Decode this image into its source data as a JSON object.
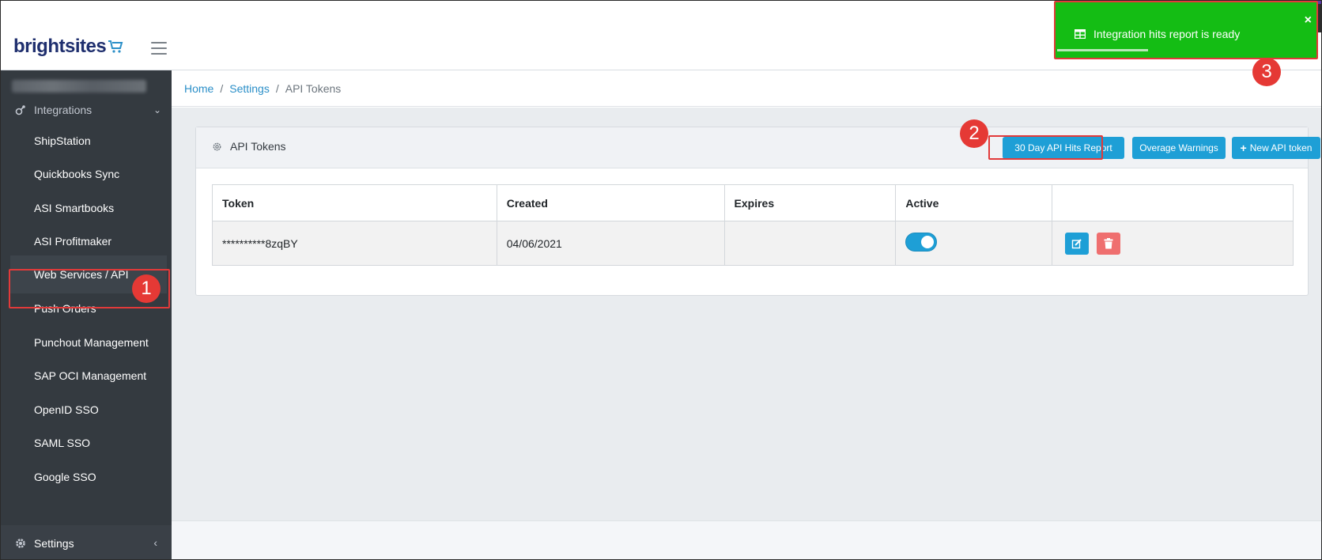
{
  "brand": {
    "name": "brightsites"
  },
  "sidebar": {
    "blurred_label": "",
    "section": {
      "label": "Integrations",
      "icon": "link-gear-icon"
    },
    "items": [
      {
        "label": "ShipStation"
      },
      {
        "label": "Quickbooks Sync"
      },
      {
        "label": "ASI Smartbooks"
      },
      {
        "label": "ASI Profitmaker"
      },
      {
        "label": "Web Services / API",
        "active": true
      },
      {
        "label": "Push Orders"
      },
      {
        "label": "Punchout Management"
      },
      {
        "label": "SAP OCI Management"
      },
      {
        "label": "OpenID SSO"
      },
      {
        "label": "SAML SSO"
      },
      {
        "label": "Google SSO"
      }
    ],
    "settings": {
      "label": "Settings",
      "icon": "gear-icon"
    }
  },
  "breadcrumb": {
    "items": [
      "Home",
      "Settings",
      "API Tokens"
    ],
    "separator": "/"
  },
  "card": {
    "title": "API Tokens",
    "buttons": {
      "hits_report": "30 Day API Hits Report",
      "overage": "Overage Warnings",
      "new_token": "New API token"
    }
  },
  "table": {
    "headers": [
      "Token",
      "Created",
      "Expires",
      "Active",
      ""
    ],
    "rows": [
      {
        "token": "**********8zqBY",
        "created": "04/06/2021",
        "expires": "",
        "active": true
      }
    ]
  },
  "toast": {
    "message": "Integration hits report is ready",
    "close": "×",
    "progress": 0.35
  },
  "annotations": {
    "step1": "1",
    "step2": "2",
    "step3": "3"
  },
  "colors": {
    "primary": "#1e9fd6",
    "sidebar_bg": "#343a40",
    "toast_bg": "#14bd14",
    "danger": "#ef6f6f",
    "annotation": "#e53935"
  }
}
